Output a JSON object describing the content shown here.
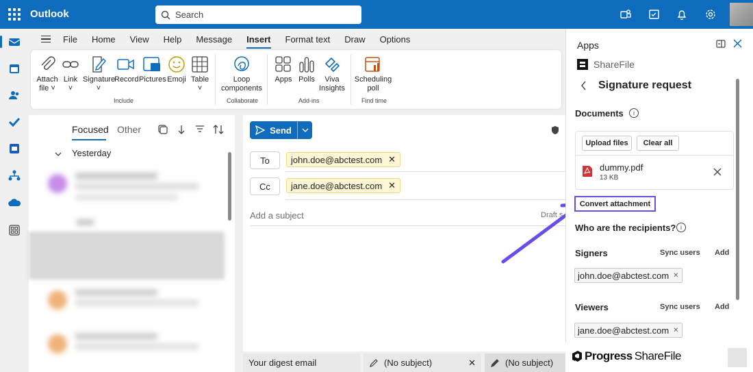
{
  "topbar": {
    "app_title": "Outlook",
    "search_placeholder": "Search"
  },
  "menu": {
    "tabs": [
      "File",
      "Home",
      "View",
      "Help",
      "Message",
      "Insert",
      "Format text",
      "Draw",
      "Options"
    ],
    "active": "Insert"
  },
  "ribbon": {
    "include": {
      "label": "Include",
      "items": [
        "Attach file",
        "Link",
        "Signature",
        "Record",
        "Pictures",
        "Emoji",
        "Table"
      ]
    },
    "collaborate": {
      "label": "Collaborate",
      "items": [
        "Loop components"
      ]
    },
    "addins": {
      "label": "Add-ins",
      "items": [
        "Apps",
        "Polls",
        "Viva Insights"
      ]
    },
    "findtime": {
      "label": "Find time",
      "items": [
        "Scheduling poll"
      ]
    }
  },
  "mail_list": {
    "focused": "Focused",
    "other": "Other",
    "group": "Yesterday"
  },
  "compose": {
    "send_label": "Send",
    "to_label": "To",
    "cc_label": "Cc",
    "to": "john.doe@abctest.com",
    "cc": "jane.doe@abctest.com",
    "subject_placeholder": "Add a subject",
    "draft_status": "Draft s"
  },
  "bottom_tabs": [
    "Your digest email",
    "(No subject)",
    "(No subject)"
  ],
  "panel": {
    "header": "Apps",
    "brand": "ShareFile",
    "title": "Signature request",
    "documents_label": "Documents",
    "upload_label": "Upload files",
    "clear_label": "Clear all",
    "file": {
      "name": "dummy.pdf",
      "size": "13 KB"
    },
    "convert_label": "Convert attachment",
    "recipients_label": "Who are the recipients?",
    "signers_label": "Signers",
    "signer": "john.doe@abctest.com",
    "viewers_label": "Viewers",
    "viewer": "jane.doe@abctest.com",
    "sync_label": "Sync users",
    "add_label": "Add",
    "footer_brand": "Progress",
    "footer_product": "ShareFile"
  },
  "colors": {
    "brand": "#0f6cbd",
    "highlight": "#6a4ce6",
    "chip": "#fef6d4"
  }
}
